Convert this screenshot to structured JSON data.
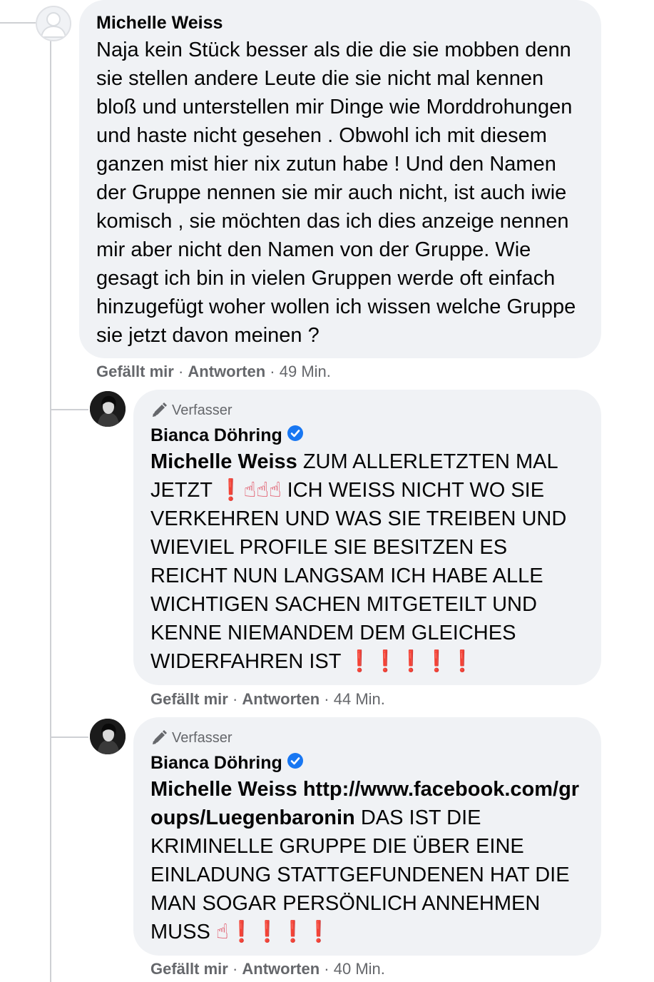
{
  "comment1": {
    "author": "Michelle Weiss",
    "text": "Naja kein Stück besser als die die sie mobben denn sie stellen andere Leute die sie nicht mal kennen bloß und unterstellen mir Dinge wie Morddrohungen und haste nicht gesehen . Obwohl ich mit diesem ganzen mist hier nix zutun habe ! Und den Namen der Gruppe nennen sie mir auch nicht, ist auch iwie komisch , sie möchten das ich dies anzeige nennen mir aber nicht den Namen von der Gruppe. Wie gesagt ich bin in vielen Gruppen werde oft einfach hinzugefügt woher wollen ich wissen welche Gruppe sie jetzt davon meinen ?",
    "like": "Gefällt mir",
    "sep": "·",
    "reply": "Antworten",
    "time": "49 Min."
  },
  "reply1": {
    "badge": "Verfasser",
    "author": "Bianca Döhring",
    "mention": "Michelle Weiss",
    "text_a": " ZUM ALLERLETZTEN MAL JETZT ",
    "emojis_a": "❗☝☝☝",
    "text_b": " ICH WEISS NICHT WO SIE VERKEHREN UND WAS SIE TREIBEN UND WIEVIEL PROFILE SIE BESITZEN ES REICHT NUN LANGSAM ICH HABE ALLE WICHTIGEN SACHEN MITGETEILT UND KENNE NIEMANDEM DEM GLEICHES WIDERFAHREN IST ",
    "emojis_b": "❗❗❗❗❗",
    "like": "Gefällt mir",
    "sep": "·",
    "reply": "Antworten",
    "time": "44 Min."
  },
  "reply2": {
    "badge": "Verfasser",
    "author": "Bianca Döhring",
    "mention": "Michelle Weiss",
    "link": "http://www.facebook.com/groups/Luegenbaronin",
    "text": " DAS IST DIE KRIMINELLE GRUPPE DIE ÜBER EINE EINLADUNG STATTGEFUNDENEN HAT DIE MAN SOGAR PERSÖNLICH ANNEHMEN MUSS ",
    "emojis": "☝❗❗❗❗",
    "like": "Gefällt mir",
    "sep": "·",
    "reply": "Antworten",
    "time": "40 Min."
  },
  "icons": {
    "verified": "verified-badge-icon",
    "pen": "pen-icon",
    "avatar": "profile-avatar"
  },
  "colors": {
    "bubble": "#f0f2f5",
    "meta": "#65676b",
    "verified": "#1877f2",
    "thread": "#ced0d4"
  }
}
